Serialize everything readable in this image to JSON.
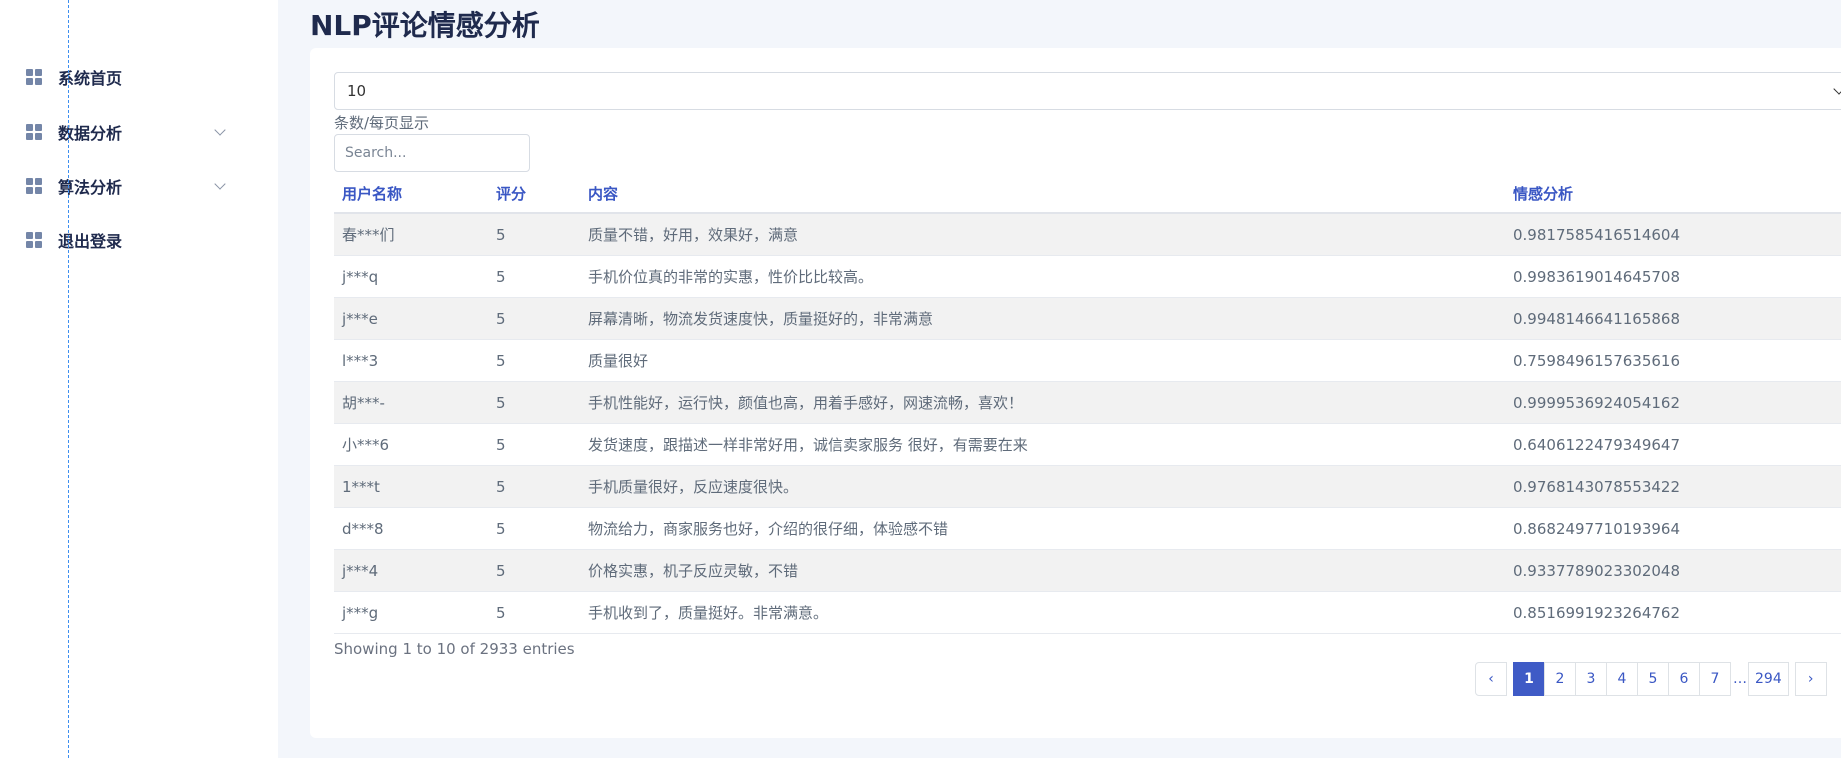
{
  "page": {
    "title": "NLP评论情感分析"
  },
  "sidebar": {
    "items": [
      {
        "label": "系统首页",
        "icon": "grid-icon",
        "has_submenu": false
      },
      {
        "label": "数据分析",
        "icon": "grid-icon",
        "has_submenu": true
      },
      {
        "label": "算法分析",
        "icon": "grid-icon",
        "has_submenu": true
      },
      {
        "label": "退出登录",
        "icon": "grid-icon",
        "has_submenu": false
      }
    ]
  },
  "controls": {
    "page_size_value": "10",
    "page_size_label": "条数/每页显示",
    "search_placeholder": "Search..."
  },
  "table": {
    "columns": [
      "用户名称",
      "评分",
      "内容",
      "情感分析"
    ],
    "rows": [
      [
        "春***们",
        "5",
        "质量不错，好用，效果好，满意",
        "0.9817585416514604"
      ],
      [
        "j***q",
        "5",
        "手机价位真的非常的实惠，性价比比较高。",
        "0.9983619014645708"
      ],
      [
        "j***e",
        "5",
        "屏幕清晰，物流发货速度快，质量挺好的，非常满意",
        "0.9948146641165868"
      ],
      [
        "l***3",
        "5",
        "质量很好",
        "0.7598496157635616"
      ],
      [
        "胡***-",
        "5",
        "手机性能好，运行快，颜值也高，用着手感好，网速流畅，喜欢！",
        "0.9999536924054162"
      ],
      [
        "小***6",
        "5",
        "发货速度，跟描述一样非常好用，诚信卖家服务 很好，有需要在来",
        "0.6406122479349647"
      ],
      [
        "1***t",
        "5",
        "手机质量很好，反应速度很快。",
        "0.9768143078553422"
      ],
      [
        "d***8",
        "5",
        "物流给力，商家服务也好，介绍的很仔细，体验感不错",
        "0.8682497710193964"
      ],
      [
        "j***4",
        "5",
        "价格实惠，机子反应灵敏，不错",
        "0.9337789023302048"
      ],
      [
        "j***g",
        "5",
        "手机收到了，质量挺好。非常满意。",
        "0.8516991923264762"
      ]
    ]
  },
  "info": {
    "text": "Showing 1 to 10 of 2933 entries"
  },
  "pagination": {
    "prev": "‹",
    "next": "›",
    "pages": [
      "1",
      "2",
      "3",
      "4",
      "5",
      "6",
      "7"
    ],
    "ellipsis": "…",
    "last": "294",
    "current": "1"
  },
  "colors": {
    "accent": "#3f5bc6",
    "header_text": "#3a57c4",
    "title_text": "#1f2a4d",
    "row_stripe": "#f2f2f2",
    "page_bg": "#f3f6fb"
  }
}
